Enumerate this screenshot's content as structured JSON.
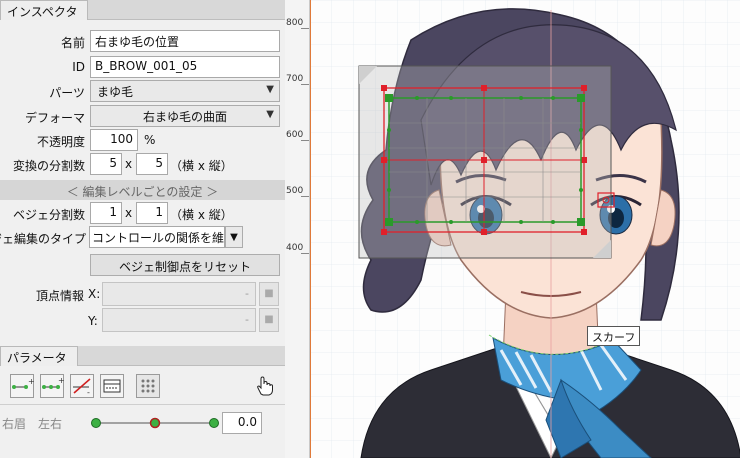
{
  "inspector": {
    "tab_label": "インスペクタ",
    "name_label": "名前",
    "name_value": "右まゆ毛の位置",
    "id_label": "ID",
    "id_value": "B_BROW_001_05",
    "parts_label": "パーツ",
    "parts_value": "まゆ毛",
    "deformer_label": "デフォーマ",
    "deformer_value": "右まゆ毛の曲面",
    "opacity_label": "不透明度",
    "opacity_value": "100",
    "opacity_unit": "%",
    "divisions_label": "変換の分割数",
    "divisions_x": "5",
    "divisions_y": "5",
    "times": "x",
    "hv_label": "（横 x 縦）",
    "section_label": "＜ 編集レベルごとの設定 ＞",
    "bezier_div_label": "ベジェ分割数",
    "bezier_div_x": "1",
    "bezier_div_y": "1",
    "bezier_type_label": "ベジェ編集のタイプ",
    "bezier_type_value": "コントロールの関係を維持",
    "reset_button": "ベジェ制御点をリセット",
    "vertex_label": "頂点情報",
    "x_label": "X:",
    "y_label": "Y:",
    "dash": "-"
  },
  "parameters": {
    "tab_label": "パラメータ",
    "row_label": "右眉　左右",
    "row_value": "0.0",
    "slider_position": 0.5
  },
  "ruler": {
    "ticks": [
      "800",
      "700",
      "600",
      "500",
      "400"
    ]
  },
  "canvas": {
    "tooltip": "スカーフ"
  },
  "colors": {
    "panel_bg": "#f0f0f0",
    "accent_orange": "#e07a3a",
    "deformer_red": "#e0202a",
    "deformer_green": "#2a9a2a",
    "slider_green": "#3cb043"
  }
}
